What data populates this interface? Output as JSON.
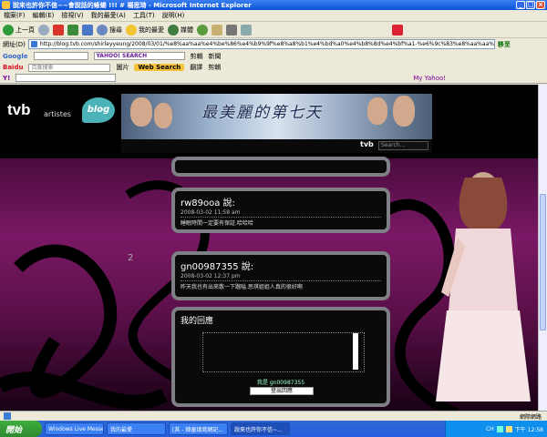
{
  "window": {
    "title": "說來也許你不信~~會說話的蜥蜴 !!! # 楊思琦 - Microsoft Internet Explorer",
    "controls": [
      "_",
      "□",
      "×"
    ]
  },
  "menu": {
    "items": [
      "檔案(F)",
      "編輯(E)",
      "檢視(V)",
      "我的最愛(A)",
      "工具(T)",
      "說明(H)"
    ]
  },
  "toolbar": {
    "back": "上一頁",
    "search": "搜尋",
    "favorites": "我的最愛",
    "media": "媒體"
  },
  "address": {
    "label": "網址(D)",
    "url": "http://blog.tvb.com/shirleyyeung/2008/03/01/%e8%aa%aa%e4%be%86%e4%b9%9f%e8%a8%b1%e4%bd%a0%e4%b8%8d%e4%bf%a1-%e6%9c%83%e8%aa%aa%e8%a9%b1%e7%9a%84%e8%9c%a5%e8%9c%b4/#comment-12",
    "go": "移至"
  },
  "toolbar2": {
    "google_label": "Google",
    "yahoo_search": "YAHOO! SEARCH",
    "items": [
      "剪輯",
      "新聞"
    ]
  },
  "toolbar3": {
    "baidu": "Baidu",
    "input_placeholder": "百度搜索",
    "web_search": "Web Search",
    "items": [
      "圖片",
      "翻譯",
      "剪輯"
    ]
  },
  "toolbar4": {
    "yahoo": "Y!",
    "my_yahoo": "My Yahoo!"
  },
  "header": {
    "logo_tvb": "tvb",
    "logo_artistes": "artistes",
    "logo_blog": "blog",
    "banner_title": "最美麗的第七天",
    "search_tvb": "tvb",
    "search_placeholder": "Search..."
  },
  "comments": [
    {
      "name": "rw89ooa 說:",
      "date": "2008-03-02 11:58 am",
      "message": "睡眠時間一定要有保証.哈哈哈"
    },
    {
      "name": "gn00987355 說:",
      "date": "2008-03-02 12:37 pm",
      "message": "昨天我也有出來散一下蹓嗌.思琪姐姐人真的很好啊"
    }
  ],
  "reply": {
    "title": "我的回應",
    "signed_in_as": "我是 gn00987355",
    "logout": "登出回應"
  },
  "page_number": "2",
  "statusbar": {
    "zone": "網際網路"
  },
  "taskbar": {
    "start": "開始",
    "tasks": [
      "Windows Live Messen...",
      "我的最愛",
      "[其 - 韓童填寫網記...",
      "說來也許你不信~..."
    ],
    "clock": "下午 12:58",
    "lang": "CH"
  }
}
